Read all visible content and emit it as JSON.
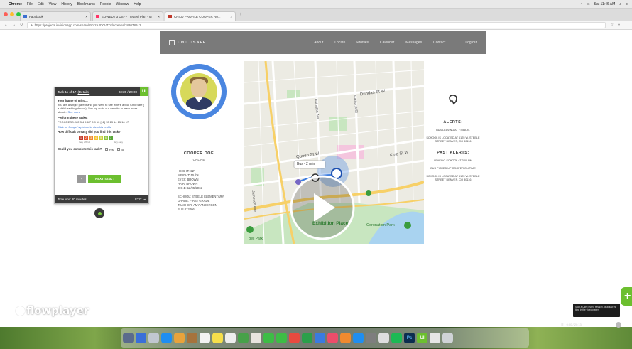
{
  "menubar": {
    "items": [
      "Chrome",
      "File",
      "Edit",
      "View",
      "History",
      "Bookmarks",
      "People",
      "Window",
      "Help"
    ],
    "clock": "Sat 11:46 AM"
  },
  "tabs": [
    {
      "label": "Facebook"
    },
    {
      "label": "EDWEDT 3 DSF - Treated Plan - M"
    },
    {
      "label": "CHILD PROFILE COOPER Ro..."
    }
  ],
  "address": {
    "url": "https://projects.invisionapp.com/share/8V42A2D0V7T#/screens/182078912"
  },
  "site": {
    "brand": "CHILDSAFE",
    "nav": [
      "About",
      "Locate",
      "Profiles",
      "Calendar",
      "Messages",
      "Contact",
      "Log out"
    ]
  },
  "profile": {
    "name": "COOPER DOE",
    "status": "ONLINE",
    "details": {
      "height": "HEIGHT: 4'2\"",
      "weight": "WEIGHT: 55 lbs",
      "eyes": "EYES: BROWN",
      "hair": "HAIR: BROWN",
      "dob": "D.O.B: 12/05/2012",
      "school": "SCHOOL: STEELE ELEMENTARY",
      "grade": "GRADE: FIRST GRADE",
      "teacher": "TEACHER: AMY ANDERSON",
      "bus": "BUS #: 3466"
    }
  },
  "map": {
    "streets": [
      "Dundas St W",
      "Queen St W",
      "King St W",
      "Ossington Ave",
      "Bathurst St",
      "Jameson Ave"
    ],
    "bus_label": "Bus - 2 min",
    "places": [
      "Exhibition Place",
      "Coronation Park",
      "Bell Park"
    ]
  },
  "alerts": {
    "title": "ALERTS:",
    "current": [
      "BUS LEAVING AT 7:45 A.M.",
      "SCHOOL IS LOCATED AT 6125 W. STEELE STREET DENVER, CO 80116"
    ],
    "past_title": "PAST ALERTS:",
    "past": [
      "LEAVING SCHOOL AT 3:00 PM",
      "BUS PICKED UP COOPER ON TIME",
      "SCHOOL IS LOCATED AT 6125 W. STEELE STREET DENVER, CO 80116"
    ]
  },
  "task": {
    "header": "Task 11 of 17",
    "header_link": "(Details)",
    "timer": "03:35 / 20:00",
    "badge": "UI",
    "frame_title": "Your frame of mind...",
    "frame_text": "You are a single parent and you want to see where about ChildSafe ( a child tracking device). You log on to our website to learn more about...",
    "see_more": "See more",
    "perform_title": "Perform these tasks:",
    "progress": "PROGRESS: 1 2 3 4 5 6 7 8 9 10 [11] 12 13 14 15 16 17",
    "task_link": "Click on Cooper's picture to view his profile",
    "difficulty_q": "How difficult or easy did you find this task?",
    "rating": [
      "1",
      "2",
      "3",
      "4",
      "5",
      "6",
      "7"
    ],
    "rate_low": "Very difficult",
    "rate_high": "Very easy",
    "complete_q": "Could you complete this task?",
    "yes": "Yes",
    "no": "No",
    "back": "‹",
    "next": "NEXT TASK ›",
    "time_limit": "Time limit: 20 minutes",
    "exit": "EXIT"
  },
  "watermark": "flowplayer",
  "tooltip": "Start a UserTesting session, or adjust the time in the video player",
  "video_ctrl": "0:00 / 20:13"
}
